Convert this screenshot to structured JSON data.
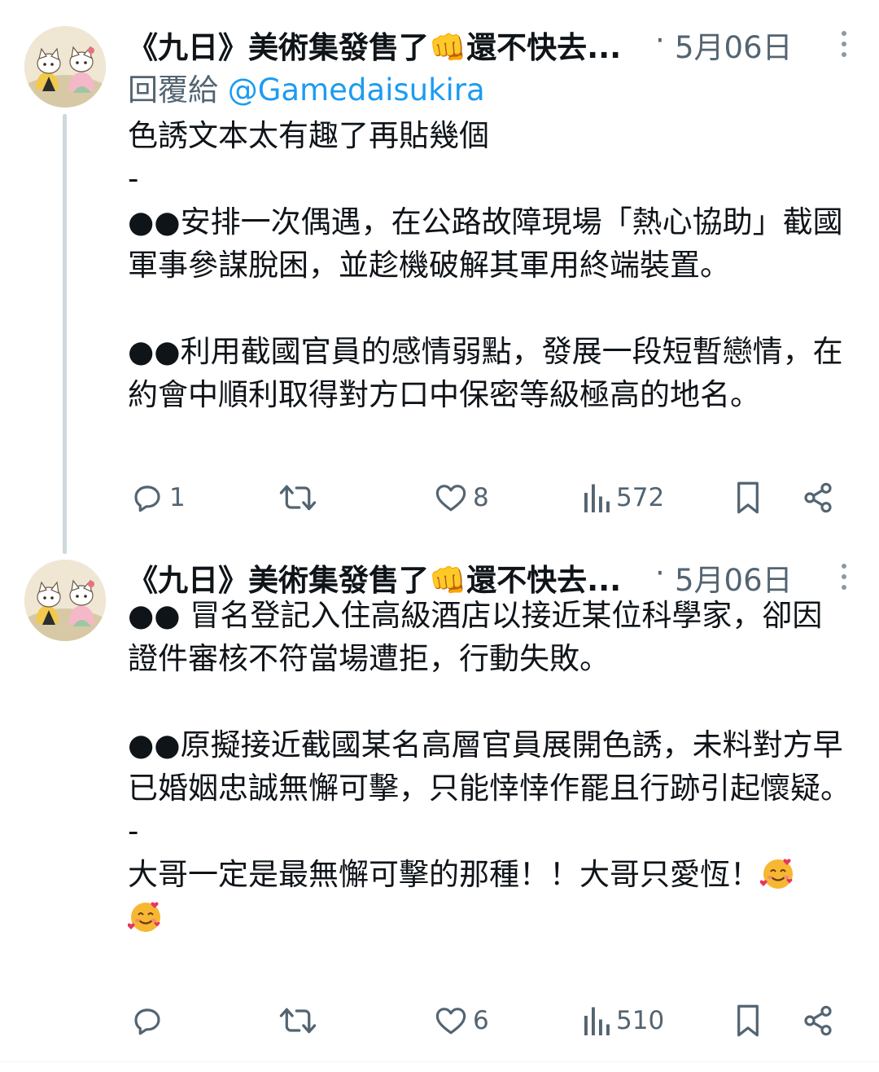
{
  "tweets": [
    {
      "author": "《九日》美術集發售了👊還不快去...",
      "dot": "·",
      "date": "5月06日",
      "reply_prefix": "回覆給",
      "reply_handle": "@Gamedaisukira",
      "lines": [
        "色誘文本太有趣了再貼幾個",
        "-",
        "●●安排一次偶遇，在公路故障現場「熱心協助」截國軍事參謀脫困，並趁機破解其軍用終端裝置。",
        "",
        "●●利用截國官員的感情弱點，發展一段短暫戀情，在約會中順利取得對方口中保密等級極高的地名。"
      ],
      "replies": "1",
      "likes": "8",
      "views": "572"
    },
    {
      "author": "《九日》美術集發售了👊還不快去...",
      "dot": "·",
      "date": "5月06日",
      "lines": [
        "●● 冒名登記入住高級酒店以接近某位科學家，卻因證件審核不符當場遭拒，行動失敗。",
        "",
        "●●原擬接近截國某名高層官員展開色誘，未料對方早已婚姻忠誠無懈可擊，只能悻悻作罷且行跡引起懷疑。",
        "-",
        "大哥一定是最無懈可擊的那種！！大哥只愛恆！"
      ],
      "emoji": "smiling-face-with-hearts",
      "replies": "",
      "likes": "6",
      "views": "510"
    }
  ]
}
